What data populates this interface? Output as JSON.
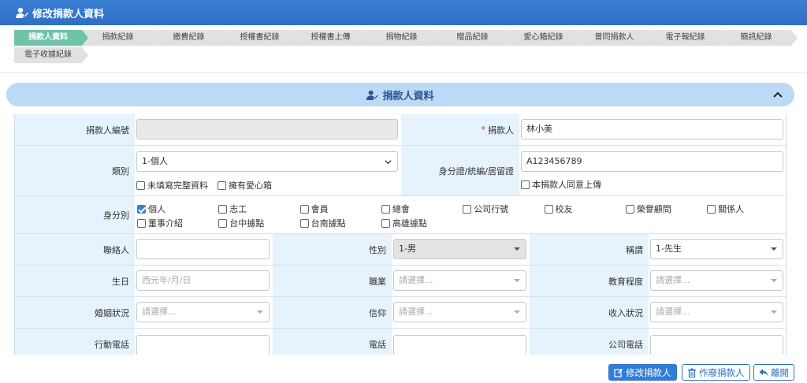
{
  "header": {
    "title": "修改捐款人資料"
  },
  "tabs_row1": [
    "捐款人資料",
    "捐款紀錄",
    "繳費紀錄",
    "授權書紀錄",
    "授權書上傳",
    "捐物紀錄",
    "贈品紀錄",
    "愛心箱紀錄",
    "曾同捐款人",
    "電子報紀錄",
    "簡訊紀錄"
  ],
  "tabs_row2": [
    "電子收據紀錄"
  ],
  "panel": {
    "title": "捐款人資料"
  },
  "form": {
    "donor_id": {
      "label": "捐款人編號",
      "value": ""
    },
    "donor_name": {
      "label": "捐款人",
      "required": "*",
      "value": "林小美"
    },
    "category": {
      "label": "類別",
      "value": "1-個人"
    },
    "incomplete": {
      "label": "未填寫完整資料"
    },
    "has_box": {
      "label": "擁有愛心箱"
    },
    "idnum": {
      "label": "身分證/統編/居留證",
      "value": "A123456789"
    },
    "consent": {
      "label": "本捐款人同意上傳"
    },
    "identity": {
      "label": "身分別",
      "options": [
        "個人",
        "志工",
        "會員",
        "總會",
        "公司行號",
        "校友",
        "榮譽顧問",
        "關係人",
        "董事介紹",
        "台中據點",
        "台南據點",
        "高雄據點"
      ]
    },
    "contact": {
      "label": "聯絡人",
      "value": ""
    },
    "gender": {
      "label": "性別",
      "value": "1-男"
    },
    "title": {
      "label": "稱謂",
      "value": "1-先生"
    },
    "birthday": {
      "label": "生日",
      "placeholder": "西元年/月/日"
    },
    "occupation": {
      "label": "職業",
      "placeholder": "請選擇..."
    },
    "education": {
      "label": "教育程度",
      "placeholder": "請選擇..."
    },
    "marital": {
      "label": "婚姻狀況",
      "placeholder": "請選擇..."
    },
    "religion": {
      "label": "信仰",
      "placeholder": "請選擇..."
    },
    "income": {
      "label": "收入狀況",
      "placeholder": "請選擇..."
    },
    "mobile": {
      "label": "行動電話",
      "value": ""
    },
    "phone": {
      "label": "電話",
      "value": ""
    },
    "company_phone": {
      "label": "公司電話",
      "value": ""
    }
  },
  "buttons": {
    "save": "修改捐款人",
    "void": "作廢捐款人",
    "leave": "離開"
  },
  "colors": {
    "header": "#2f6fc5",
    "active_tab": "#6fc3a8",
    "label_bg": "#e6f2fc",
    "panel_head": "#bcd9f6"
  }
}
